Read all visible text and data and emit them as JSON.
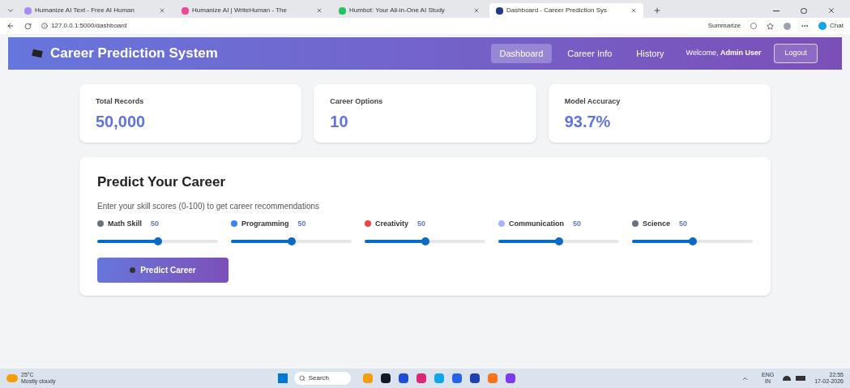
{
  "browser": {
    "tabs": [
      {
        "title": "Humanize AI Text - Free AI Human",
        "selected": false
      },
      {
        "title": "Humanize AI | WriteHuman - The",
        "selected": false
      },
      {
        "title": "Humbot: Your All-in-One AI Study",
        "selected": false
      },
      {
        "title": "Dashboard - Career Prediction Sys",
        "selected": true
      }
    ],
    "url": "127.0.0.1:5000/dashboard",
    "summarize": "Summarize",
    "chat": "Chat"
  },
  "header": {
    "title": "Career Prediction System",
    "nav": [
      {
        "label": "Dashboard",
        "selected": true
      },
      {
        "label": "Career Info",
        "selected": false
      },
      {
        "label": "History",
        "selected": false
      }
    ],
    "welcome": "Welcome, **Admin User**",
    "logout": "Logout"
  },
  "stats": [
    {
      "label": "Total Records",
      "value": "50,000"
    },
    {
      "label": "Career Options",
      "value": "10"
    },
    {
      "label": "Model Accuracy",
      "value": "93.7%"
    }
  ],
  "predict": {
    "title": "Predict Your Career",
    "subtitle": "Enter your skill scores (0-100) to get career recommendations",
    "skills": [
      {
        "name": "Math Skill",
        "value": "50",
        "level": 0.5
      },
      {
        "name": "Programming",
        "value": "50",
        "level": 0.5
      },
      {
        "name": "Creativity",
        "value": "50",
        "level": 0.5
      },
      {
        "name": "Communication",
        "value": "50",
        "level": 0.5
      },
      {
        "name": "Science",
        "value": "50",
        "level": 0.5
      }
    ],
    "button": "Predict Career"
  },
  "taskbar": {
    "temperature": "25°C",
    "weather": "Mostly cloudy",
    "search": "Search",
    "language": "ENG",
    "region": "IN",
    "time": "22:55",
    "date": "17-02-2026"
  }
}
